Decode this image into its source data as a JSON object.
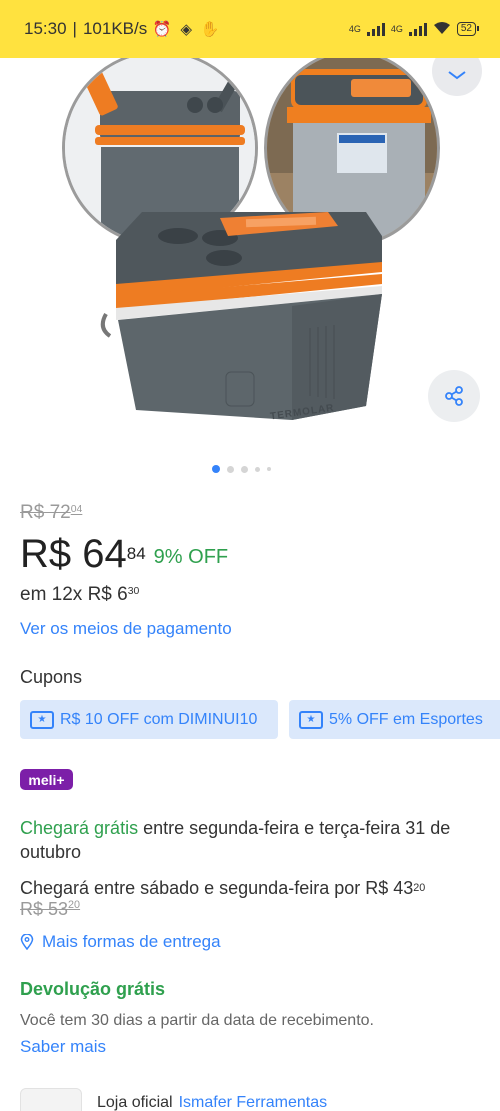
{
  "status_bar": {
    "time": "15:30",
    "speed": "101KB/s",
    "network1": "4G",
    "network2": "4G",
    "battery": "52"
  },
  "price": {
    "old_integer": "R$ 72",
    "old_cents": "04",
    "current_integer": "R$ 64",
    "current_cents": "84",
    "discount": "9% OFF",
    "installments_prefix": "em 12x R$ 6",
    "installments_cents": "30",
    "payment_link": "Ver os meios de pagamento"
  },
  "coupons": {
    "title": "Cupons",
    "items": [
      {
        "label": "R$ 10 OFF com DIMINUI10"
      },
      {
        "label": "5% OFF em Esportes"
      }
    ]
  },
  "meli_badge": "meli+",
  "shipping": {
    "free_label": "Chegará grátis",
    "free_rest": " entre segunda-feira e terça-feira 31 de outubro",
    "paid_prefix": "Chegará entre sábado e segunda-feira por R$ 43",
    "paid_cents": "20",
    "paid_old": "R$ 53",
    "paid_old_cents": "20",
    "more_link": "Mais formas de entrega"
  },
  "returns": {
    "title": "Devolução grátis",
    "text": "Você tem 30 dias a partir da data de recebimento.",
    "link": "Saber mais"
  },
  "store": {
    "prefix": "Loja oficial",
    "name": "Ismafer Ferramentas"
  },
  "gallery": {
    "product_logo": "TERMOLAR",
    "total_images": 5,
    "active_image": 1
  },
  "colors": {
    "status_bar": "#ffe23f",
    "link": "#3483fa",
    "green": "#2fa04e",
    "coupon_bg": "#dbe8fb",
    "meli_purple": "#7c1fa8"
  }
}
